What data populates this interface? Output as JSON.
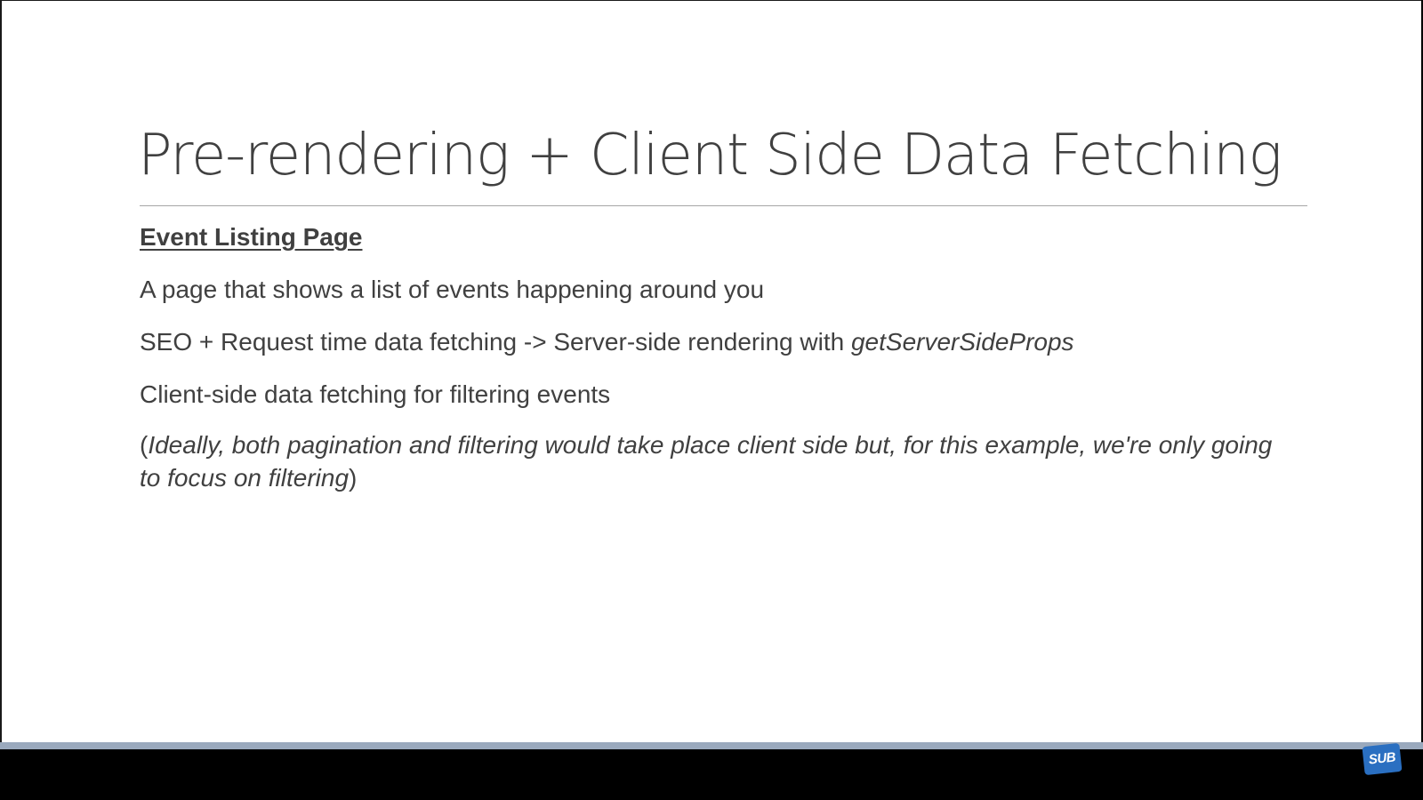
{
  "slide": {
    "title": "Pre-rendering + Client Side Data Fetching",
    "subheading": "Event Listing Page",
    "line1": "A page that shows a list of events happening around you",
    "line2_prefix": "SEO + Request time data fetching -> Server-side rendering with ",
    "line2_code": "getServerSideProps",
    "line3": "Client-side data fetching for filtering events",
    "note_open": "(",
    "note_italic": "Ideally, both pagination and filtering would take place client side but, for this example, we're only going to focus on filtering",
    "note_close": ")"
  },
  "player": {
    "progress": 1.0,
    "badge_label": "SUB",
    "badge_color": "#2a6fc1"
  }
}
